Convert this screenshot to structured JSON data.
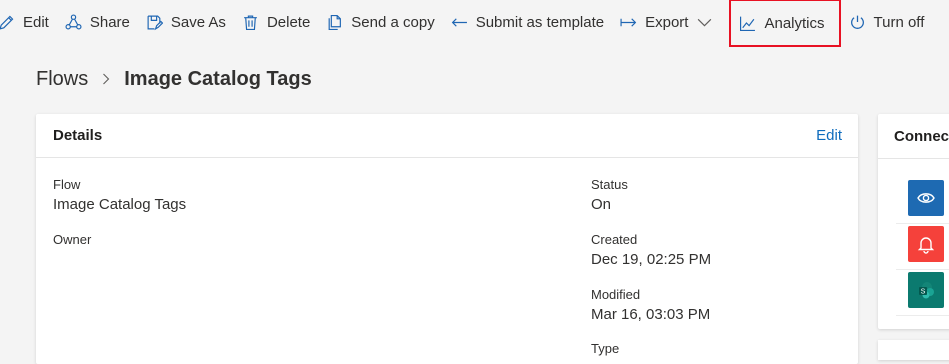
{
  "toolbar": {
    "items": [
      {
        "label": "Edit",
        "icon": "pencil-icon"
      },
      {
        "label": "Share",
        "icon": "share-icon"
      },
      {
        "label": "Save As",
        "icon": "save-as-icon"
      },
      {
        "label": "Delete",
        "icon": "trash-icon"
      },
      {
        "label": "Send a copy",
        "icon": "copy-icon"
      },
      {
        "label": "Submit as template",
        "icon": "arrow-left-icon"
      },
      {
        "label": "Export",
        "icon": "arrow-right-icon"
      },
      {
        "label": "Analytics",
        "icon": "chart-icon"
      },
      {
        "label": "Turn off",
        "icon": "power-icon"
      }
    ]
  },
  "breadcrumb": {
    "root": "Flows",
    "current": "Image Catalog Tags"
  },
  "details": {
    "title": "Details",
    "edit_label": "Edit",
    "flow_label": "Flow",
    "flow_value": "Image Catalog Tags",
    "owner_label": "Owner",
    "status_label": "Status",
    "status_value": "On",
    "created_label": "Created",
    "created_value": "Dec 19, 02:25 PM",
    "modified_label": "Modified",
    "modified_value": "Mar 16, 03:03 PM",
    "type_label": "Type"
  },
  "connections": {
    "title": "Connections",
    "icons": [
      {
        "name": "eye-icon",
        "color": "#1e6ab2"
      },
      {
        "name": "bell-icon",
        "color": "#f5413b"
      },
      {
        "name": "sharepoint-icon",
        "color": "#0b7a6f"
      }
    ]
  },
  "colors": {
    "accent": "#0f6cbd",
    "highlight_border": "#e81123",
    "background": "#f4f4f4"
  }
}
